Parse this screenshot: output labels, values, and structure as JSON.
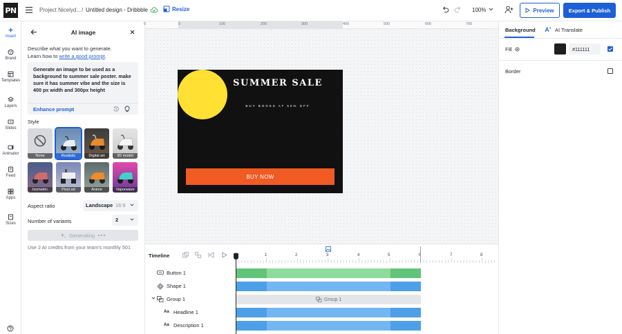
{
  "app": {
    "logo": "PN"
  },
  "header": {
    "project": "Project Nicelyd...",
    "separator": "/",
    "design_title": "Untitled design - Dribbble",
    "resize_label": "Resize",
    "zoom": "100%",
    "preview_label": "Preview",
    "export_label": "Export & Publish"
  },
  "nav": [
    {
      "label": "Insert",
      "icon": "plus-icon"
    },
    {
      "label": "Brand",
      "icon": "brand-icon"
    },
    {
      "label": "Templates",
      "icon": "templates-icon"
    },
    {
      "label": "Layers",
      "icon": "layers-icon"
    },
    {
      "label": "Slides",
      "icon": "slides-icon"
    },
    {
      "label": "Animator",
      "icon": "animator-icon"
    },
    {
      "label": "Feed",
      "icon": "feed-icon"
    },
    {
      "label": "Apps",
      "icon": "apps-icon"
    },
    {
      "label": "Sizes",
      "icon": "sizes-icon"
    }
  ],
  "panel": {
    "title": "AI image",
    "desc_prefix": "Describe what you want to generate.",
    "desc_learn": "Learn how to ",
    "desc_link": "write a good prompt",
    "desc_suffix": ".",
    "prompt": "Generate an image to be used as a background to summer sale poster. make sure it has summer vibe and the size is 400 px width and 300px height",
    "enhance_label": "Enhance prompt",
    "style_label": "Style",
    "styles": [
      "None",
      "Realistic",
      "Digital art",
      "3D model",
      "Isometric",
      "Pixel art",
      "Anime",
      "Vaporwave"
    ],
    "selected_style": "Realistic",
    "aspect_label": "Aspect ratio",
    "aspect_value": "Landscape",
    "aspect_ratio": "16:9",
    "variants_label": "Number of variants",
    "variants_value": "2",
    "generate_label": "Generating",
    "credits": "Use 2 AI credits from your team's monthly 501"
  },
  "ruler": [
    "0",
    "0",
    "100",
    "200",
    "300",
    "400",
    "500",
    "600",
    "700"
  ],
  "poster": {
    "headline": "SUMMER SALE",
    "subline": "BUY BOOKS AT 50% OFF",
    "button": "BUY NOW",
    "background": "#111111",
    "sun_color": "#ffe033",
    "button_color": "#f05a23"
  },
  "right_panel": {
    "tab_background": "Background",
    "tab_translate": "AI Translate",
    "fill_label": "Fill",
    "fill_hex": "#111111",
    "border_label": "Border"
  },
  "timeline": {
    "title": "Timeline",
    "ticks": [
      "1",
      "2",
      "3",
      "4",
      "5",
      "6",
      "7",
      "8"
    ],
    "layers": [
      {
        "name": "Button 1",
        "icon": "button-icon"
      },
      {
        "name": "Shape 1",
        "icon": "shape-icon"
      },
      {
        "name": "Group 1",
        "icon": "group-icon"
      },
      {
        "name": "Headline 1",
        "icon": "text-icon"
      },
      {
        "name": "Description 1",
        "icon": "text-icon"
      }
    ],
    "group_track_label": "Group 1"
  }
}
